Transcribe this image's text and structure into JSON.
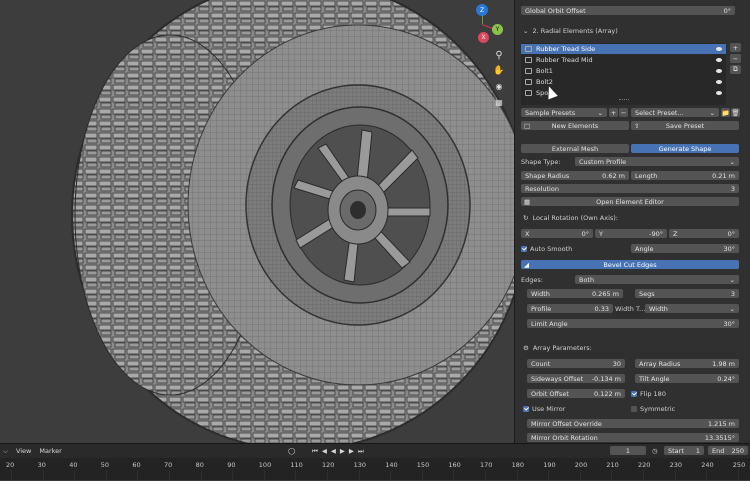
{
  "panel": {
    "global_orbit_offset": {
      "label": "Global Orbit Offset",
      "value": "0°"
    },
    "radial_header": "2. Radial Elements (Array)",
    "elements": [
      "Rubber Tread Side",
      "Rubber Tread Mid",
      "Bolt1",
      "Bolt2",
      "Spo..."
    ],
    "presets_dropdown": "Sample Presets",
    "select_preset": "Select Preset...",
    "new_elements": "New Elements",
    "save_preset": "Save Preset",
    "tab_external": "External Mesh",
    "tab_generate": "Generate Shape",
    "shape_type": {
      "label": "Shape Type:",
      "value": "Custom Profile"
    },
    "shape_radius": {
      "label": "Shape Radius",
      "value": "0.62 m"
    },
    "length": {
      "label": "Length",
      "value": "0.21 m"
    },
    "resolution": {
      "label": "Resolution",
      "value": "3"
    },
    "open_editor": "Open Element Editor",
    "local_rotation": "Local Rotation (Own Axis):",
    "rot_x": {
      "label": "X",
      "value": "0°"
    },
    "rot_y": {
      "label": "Y",
      "value": "-90°"
    },
    "rot_z": {
      "label": "Z",
      "value": "0°"
    },
    "auto_smooth": "Auto Smooth",
    "angle": {
      "label": "Angle",
      "value": "30°"
    },
    "bevel_cut_edges": "Bevel Cut Edges",
    "edges": {
      "label": "Edges:",
      "value": "Both"
    },
    "width": {
      "label": "Width",
      "value": "0.265 m"
    },
    "segs": {
      "label": "Segs",
      "value": "3"
    },
    "profile": {
      "label": "Profile",
      "value": "0.33"
    },
    "width_type": {
      "label": "Width T...",
      "value": "Width"
    },
    "limit_angle": {
      "label": "Limit Angle",
      "value": "30°"
    },
    "array_params": "Array Parameters:",
    "count": {
      "label": "Count",
      "value": "30"
    },
    "array_radius": {
      "label": "Array Radius",
      "value": "1.98 m"
    },
    "sideways_offset": {
      "label": "Sideways Offset",
      "value": "-0.134 m"
    },
    "tilt_angle": {
      "label": "Tilt Angle",
      "value": "0.24°"
    },
    "orbit_offset": {
      "label": "Orbit Offset",
      "value": "0.122 m"
    },
    "flip_180": "Flip 180",
    "use_mirror": "Use Mirror",
    "symmetric": "Symmetric",
    "mirror_offset_override": {
      "label": "Mirror Offset Override",
      "value": "1.215 m"
    },
    "mirror_orbit_rotation": {
      "label": "Mirror Orbit Rotation",
      "value": "13.3515°"
    }
  },
  "gizmo": {
    "x": "X",
    "y": "Y",
    "z": "Z"
  },
  "timeline": {
    "view": "View",
    "marker": "Marker",
    "current_frame": "1",
    "start_label": "Start",
    "start_value": "1",
    "end_label": "End",
    "end_value": "250",
    "ticks": [
      "20",
      "30",
      "40",
      "50",
      "60",
      "70",
      "80",
      "90",
      "100",
      "110",
      "120",
      "130",
      "140",
      "150",
      "160",
      "170",
      "180",
      "190",
      "200",
      "210",
      "220",
      "230",
      "240",
      "250"
    ]
  }
}
